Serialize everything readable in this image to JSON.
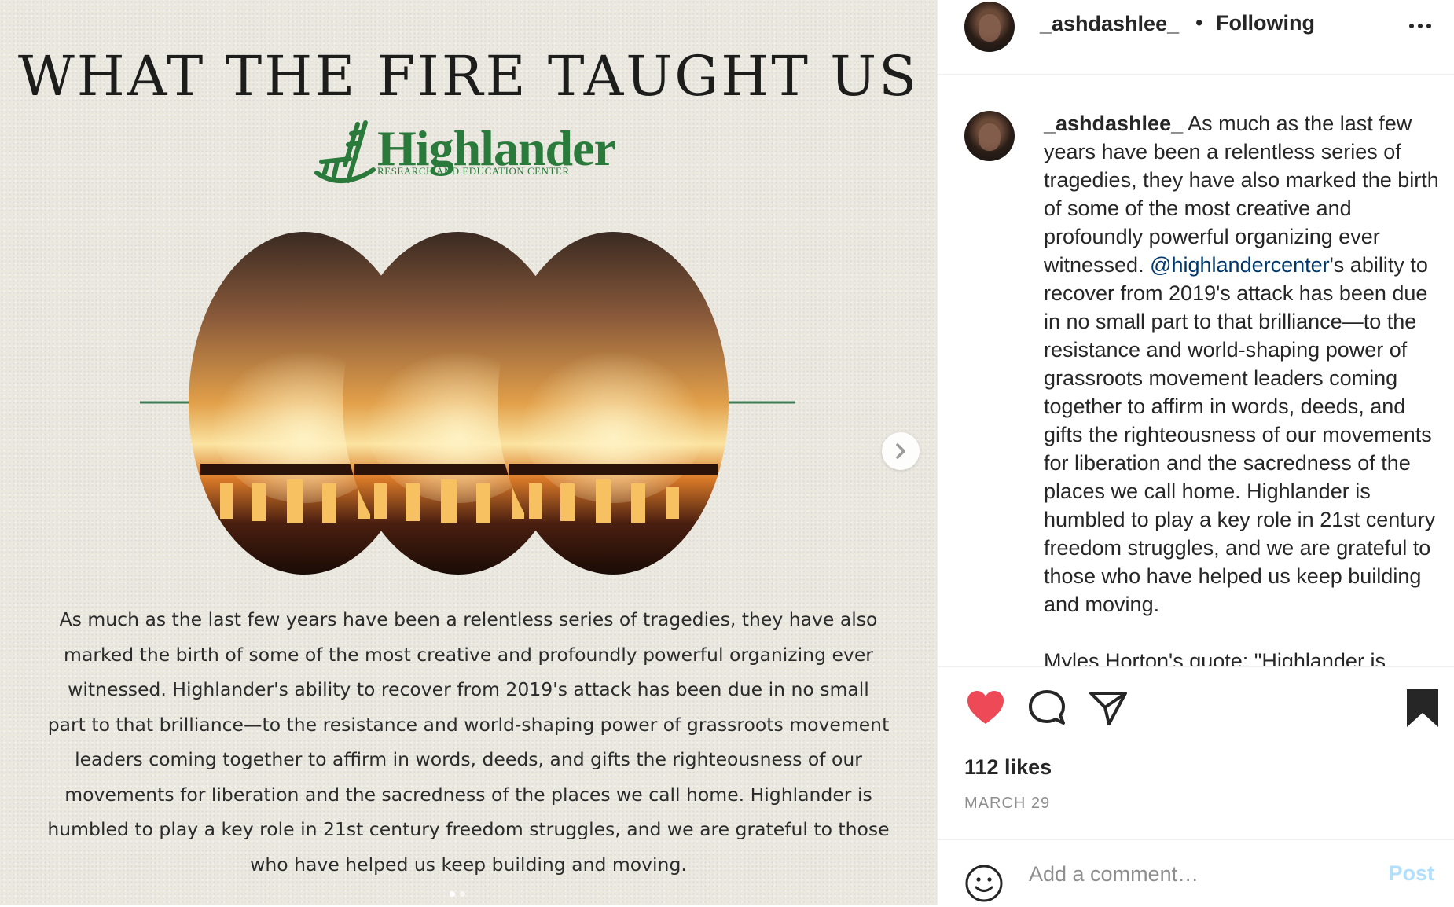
{
  "post": {
    "headline": "WHAT THE FIRE TAUGHT US",
    "logo": {
      "name": "Highlander",
      "subtitle": "Research and Education Center"
    },
    "quote": "As much as the last few years have been a relentless series of tragedies, they have also marked the birth of some of the most creative and profoundly powerful organizing ever witnessed. Highlander's ability to recover from 2019's attack has been due in no small part to that brilliance—to the resistance and world-shaping power of grassroots movement leaders coming together to affirm in words, deeds, and gifts the righteousness of our movements for liberation and the sacredness of the places we call home. Highlander is humbled to play a key role in 21st century freedom struggles, and we are grateful to those who have helped us keep building and moving.",
    "carousel": {
      "active_index": 0,
      "count": 2
    }
  },
  "header": {
    "username": "_ashdashlee_",
    "separator": "•",
    "follow_status": "Following"
  },
  "caption": {
    "username": "_ashdashlee_",
    "text_before": " As much as the last few years have been a relentless series of tragedies, they have also marked the birth of some of the most creative and profoundly powerful organizing ever witnessed. ",
    "mention": "@highlandercenter",
    "text_after": "'s ability to recover from 2019's attack has been due in no small part to that brilliance—to the resistance and world-shaping power of grassroots movement leaders coming together to affirm in words, deeds, and gifts the righteousness of our movements for liberation and the sacredness of the places we call home. Highlander is humbled to play a key role in 21st century freedom struggles, and we are grateful to those who have helped us keep building and moving.",
    "cut_line": "Myles Horton's quote: \"Highlander is"
  },
  "actions": {
    "liked": true,
    "saved": true,
    "likes": "112 likes",
    "date": "MARCH 29"
  },
  "comment": {
    "placeholder": "Add a comment…",
    "post_label": "Post"
  },
  "colors": {
    "like_red": "#ed4956",
    "mention_blue": "#00376b",
    "logo_green": "#2a7a3c",
    "post_disabled": "#b2dffc"
  }
}
